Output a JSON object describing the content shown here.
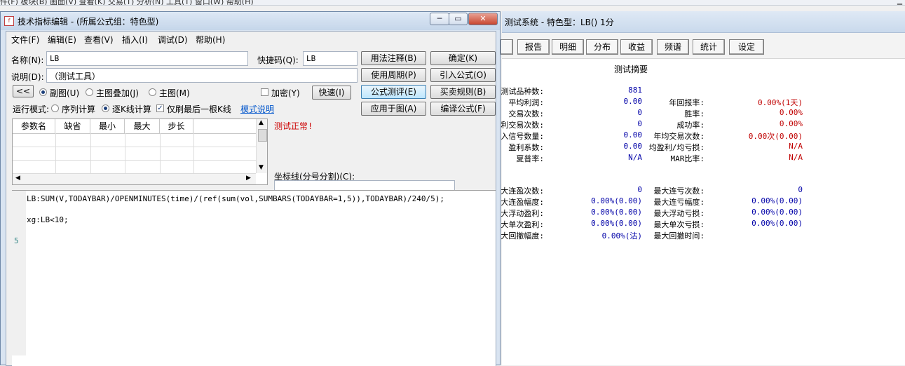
{
  "app_menubar": {
    "text": "件(F)   板块(B)   画面(V)   查看(K)   交易(T)   分析(N)   工具(T)   窗口(W)   帮助(H)"
  },
  "report": {
    "title": "测试系统 - 特色型：LB() 1分",
    "tabs": [
      "报告",
      "明细",
      "分布",
      "收益",
      "频谱",
      "统计",
      "设定"
    ],
    "summary_title": "测试摘要",
    "left_rows": [
      {
        "label": "测试品种数:",
        "value": "881"
      },
      {
        "label": "平均利润:",
        "value": "0.00"
      },
      {
        "label": "交易次数:",
        "value": "0"
      },
      {
        "label": "盈利交易次数:",
        "value": "0"
      },
      {
        "label": "买入信号数量:",
        "value": "0.00"
      },
      {
        "label": "盈利系数:",
        "value": "0.00"
      },
      {
        "label": "夏普率:",
        "value": "N/A"
      }
    ],
    "right_rows": [
      {
        "label": "",
        "value": ""
      },
      {
        "label": "年回报率:",
        "value": "0.00%(1天)"
      },
      {
        "label": "胜率:",
        "value": "0.00%"
      },
      {
        "label": "成功率:",
        "value": "0.00%"
      },
      {
        "label": "年均交易次数:",
        "value": "0.00次(0.00)"
      },
      {
        "label": "均盈利/均亏损:",
        "value": "N/A"
      },
      {
        "label": "MAR比率:",
        "value": "N/A"
      }
    ],
    "left_rows2": [
      {
        "label": "最大连盈次数:",
        "value": "0"
      },
      {
        "label": "最大连盈幅度:",
        "value": "0.00%(0.00)"
      },
      {
        "label": "最大浮动盈利:",
        "value": "0.00%(0.00)"
      },
      {
        "label": "最大单次盈利:",
        "value": "0.00%(0.00)"
      },
      {
        "label": "最大回撤幅度:",
        "value": "0.00%(沽)"
      }
    ],
    "right_rows2": [
      {
        "label": "最大连亏次数:",
        "value": "0"
      },
      {
        "label": "最大连亏幅度:",
        "value": "0.00%(0.00)"
      },
      {
        "label": "最大浮动亏损:",
        "value": "0.00%(0.00)"
      },
      {
        "label": "最大单次亏损:",
        "value": "0.00%(0.00)"
      },
      {
        "label": "最大回撤时间:",
        "value": ""
      }
    ]
  },
  "dialog": {
    "title": "技术指标编辑 - (所属公式组：特色型)",
    "menu": [
      "文件(F)",
      "编辑(E)",
      "查看(V)",
      "插入(I)",
      "调试(D)",
      "帮助(H)"
    ],
    "name_label": "名称(N):",
    "name_value": "LB",
    "hotkey_label": "快捷码(Q):",
    "hotkey_value": "LB",
    "desc_label": "说明(D):",
    "desc_value": "（测试工具）",
    "collapse_label": "<<",
    "radio_sub": "副图(U)",
    "radio_main_overlay": "主图叠加(J)",
    "radio_main": "主图(M)",
    "encrypt_label": "加密(Y)",
    "quick_label": "快速(I)",
    "run_mode_label": "运行模式:",
    "seq_calc": "序列计算",
    "kline_calc": "逐K线计算",
    "refresh_last": "仅刷最后一根K线",
    "mode_link": "模式说明",
    "buttons_col1": [
      "用法注释(B)",
      "使用周期(P)",
      "公式测评(E)",
      "应用于图(A)"
    ],
    "buttons_col2": [
      "确定(K)",
      "引入公式(O)",
      "买卖规则(B)",
      "编译公式(F)"
    ],
    "param_headers": [
      "参数名",
      "缺省",
      "最小",
      "最大",
      "步长"
    ],
    "status": "测试正常!",
    "coord_label": "坐标线(分号分割)(C):",
    "code_lines": [
      "LB:SUM(V,TODAYBAR)/OPENMINUTES(time)/(ref(sum(vol,SUMBARS(TODAYBAR=1,5)),TODAYBAR)/240/5);",
      "",
      "xg:LB<10;",
      "",
      ""
    ],
    "line_number": "5"
  },
  "colors": {
    "value_blue": "#0000a8",
    "value_red": "#c00000",
    "status_red": "#cc0000",
    "link": "#0055cc"
  }
}
